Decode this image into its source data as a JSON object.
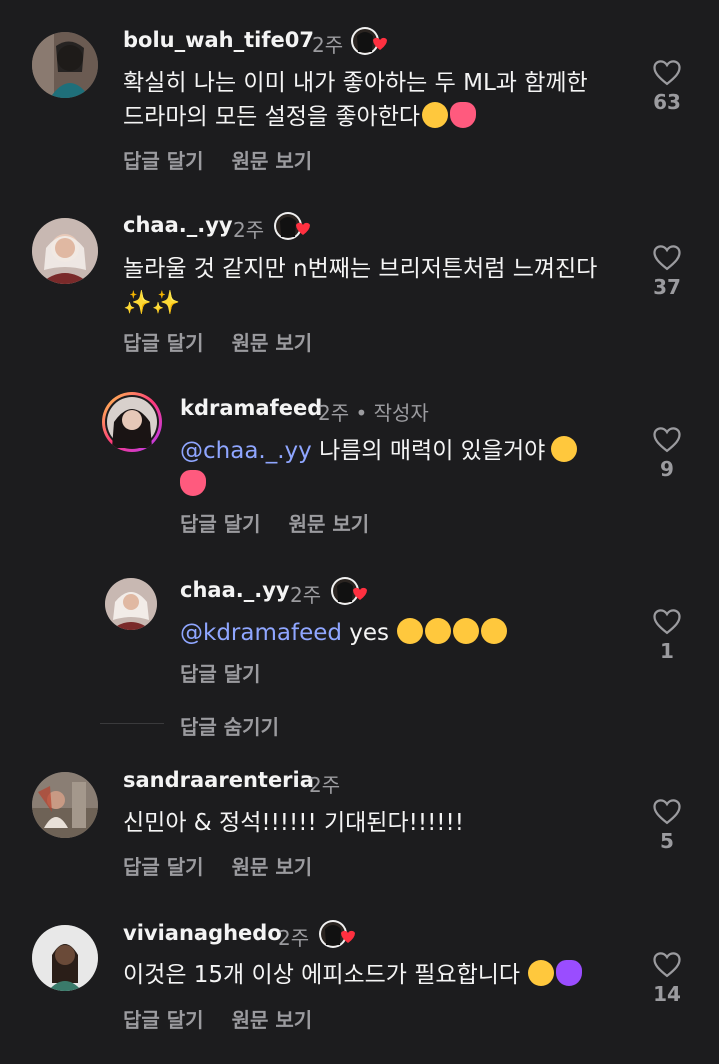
{
  "comments": [
    {
      "username": "bolu_wah_tife07",
      "time": "2주",
      "text_line1": "확실히 나는 이미 내가 좋아하는 두 ML과 함께한",
      "text_line2": "드라마의 모든 설정을 좋아한다",
      "reply_label": "답글 달기",
      "translate_label": "원문 보기",
      "likes": "63"
    },
    {
      "username": "chaa._.yy",
      "time": "2주",
      "text_line1": "놀라울 것 같지만 n번째는 브리저튼처럼 느껴진다",
      "text_line2": "✨✨",
      "reply_label": "답글 달기",
      "translate_label": "원문 보기",
      "likes": "37"
    },
    {
      "username": "kdramafeed",
      "time": "2주 • 작성자",
      "mention": "@chaa._.yy",
      "text_line1": " 나름의 매력이 있을거야",
      "reply_label": "답글 달기",
      "translate_label": "원문 보기",
      "likes": "9"
    },
    {
      "username": "chaa._.yy",
      "time": "2주",
      "mention": "@kdramafeed",
      "text_line1": " yes",
      "reply_label": "답글 달기",
      "likes": "1"
    },
    {
      "username": "sandraarenteria",
      "time": "2주",
      "text_line1": "신민아 & 정석!!!!!! 기대된다!!!!!!",
      "reply_label": "답글 달기",
      "translate_label": "원문 보기",
      "likes": "5"
    },
    {
      "username": "vivianaghedo",
      "time": "2주",
      "text_line1": "이것은 15개 이상 에피소드가 필요합니다",
      "reply_label": "답글 달기",
      "translate_label": "원문 보기",
      "likes": "14"
    }
  ],
  "hide_replies_label": "답글 숨기기",
  "icons": {
    "like": "heart-outline-icon",
    "liked_by_creator": "creator-heart-badge-icon"
  },
  "colors": {
    "background": "#1c1c1e",
    "mention": "#8fa6ff",
    "secondary_text": "#9b9b9f",
    "heart": "#ff3040"
  }
}
